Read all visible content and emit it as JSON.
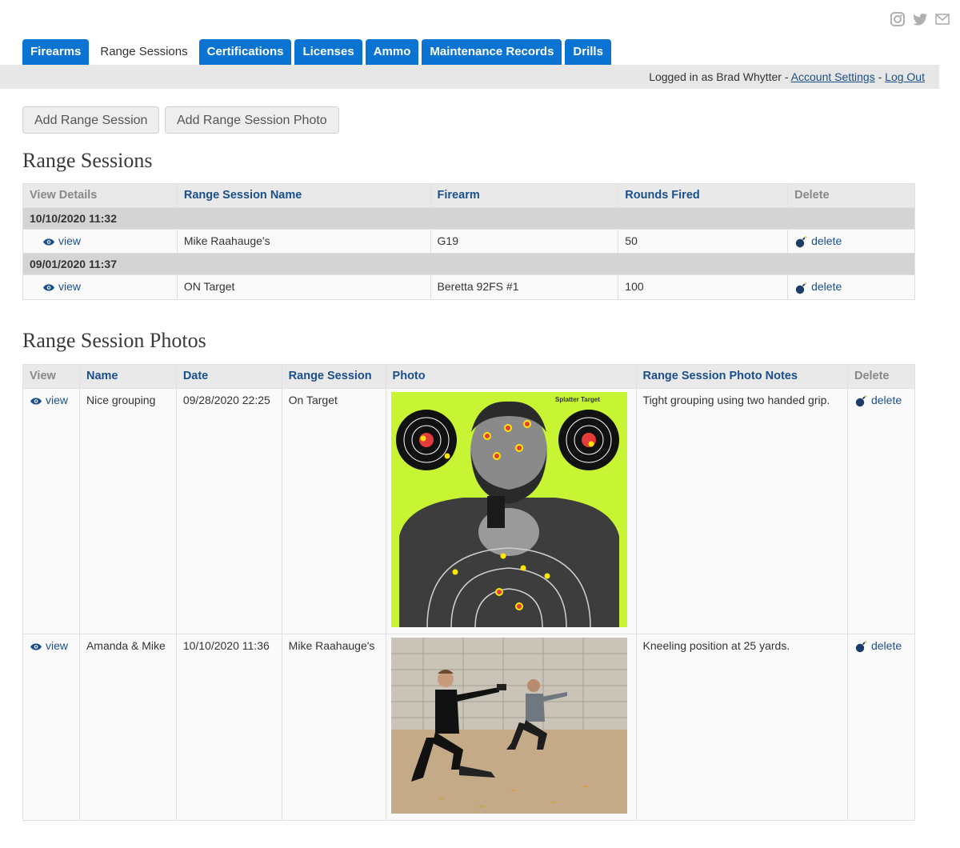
{
  "social": {
    "icons": [
      "instagram-icon",
      "twitter-icon",
      "mail-icon"
    ]
  },
  "tabs": [
    {
      "label": "Firearms",
      "active": false
    },
    {
      "label": "Range Sessions",
      "active": true
    },
    {
      "label": "Certifications",
      "active": false
    },
    {
      "label": "Licenses",
      "active": false
    },
    {
      "label": "Ammo",
      "active": false
    },
    {
      "label": "Maintenance Records",
      "active": false
    },
    {
      "label": "Drills",
      "active": false
    }
  ],
  "userbar": {
    "prefix": "Logged in as ",
    "user": "Brad Whytter",
    "sep1": " - ",
    "account_settings": "Account Settings",
    "sep2": " - ",
    "logout": "Log Out"
  },
  "actions": {
    "add_session": "Add Range Session",
    "add_photo": "Add Range Session Photo"
  },
  "sessions": {
    "title": "Range Sessions",
    "headers": [
      "View Details",
      "Range Session Name",
      "Firearm",
      "Rounds Fired",
      "Delete"
    ],
    "groups": [
      {
        "date": "10/10/2020 11:32",
        "view": "view",
        "name": "Mike Raahauge's",
        "firearm": "G19",
        "rounds": "50",
        "delete": "delete"
      },
      {
        "date": "09/01/2020 11:37",
        "view": "view",
        "name": "ON Target",
        "firearm": "Beretta 92FS #1",
        "rounds": "100",
        "delete": "delete"
      }
    ]
  },
  "photos": {
    "title": "Range Session Photos",
    "headers": [
      "View",
      "Name",
      "Date",
      "Range Session",
      "Photo",
      "Range Session Photo Notes",
      "Delete"
    ],
    "rows": [
      {
        "view": "view",
        "name": "Nice grouping",
        "date": "09/28/2020 22:25",
        "session": "On Target",
        "photo_label": "Splatter Target",
        "notes": "Tight grouping using two handed grip.",
        "delete": "delete"
      },
      {
        "view": "view",
        "name": "Amanda & Mike",
        "date": "10/10/2020 11:36",
        "session": "Mike Raahauge's",
        "notes": "Kneeling position at 25 yards.",
        "delete": "delete"
      }
    ]
  },
  "colors": {
    "tab_blue": "#0b73d1",
    "link": "#1a4f8b",
    "target_green": "#c7f534"
  }
}
